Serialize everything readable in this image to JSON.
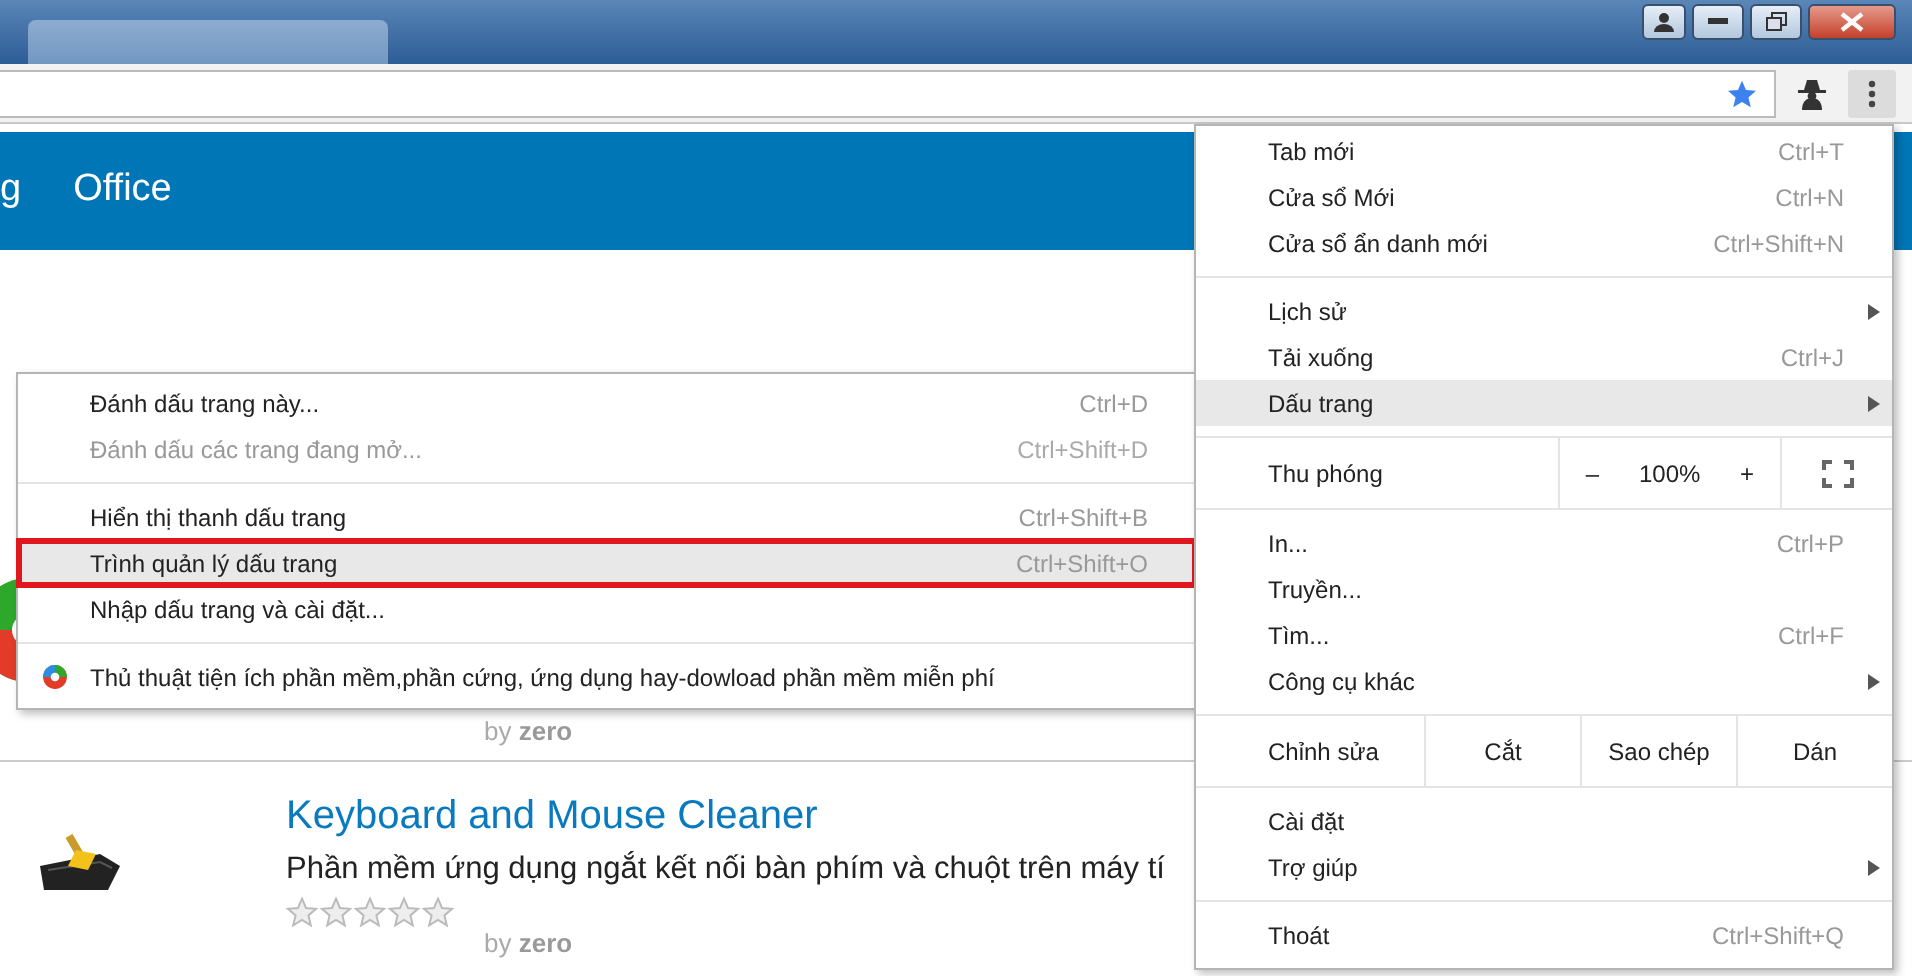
{
  "site_nav": {
    "items": [
      "g",
      "Office"
    ]
  },
  "listing": [
    {
      "kind": "partial",
      "byline": "by **zero**"
    },
    {
      "kind": "full",
      "title": "Keyboard and Mouse Cleaner",
      "description": "Phần mềm ứng dụng ngắt kết nối bàn phím và chuột trên máy tí",
      "stars": 0,
      "byline": "by **zero**"
    }
  ],
  "bookmark_submenu": [
    {
      "kind": "item",
      "label": "Đánh dấu trang này...",
      "shortcut": "Ctrl+D",
      "disabled": false,
      "selected": false,
      "outlined": false
    },
    {
      "kind": "item",
      "label": "Đánh dấu các trang đang mở...",
      "shortcut": "Ctrl+Shift+D",
      "disabled": true,
      "selected": false,
      "outlined": false
    },
    {
      "kind": "separator"
    },
    {
      "kind": "item",
      "label": "Hiển thị thanh dấu trang",
      "shortcut": "Ctrl+Shift+B",
      "disabled": false,
      "selected": false,
      "outlined": false
    },
    {
      "kind": "item",
      "label": "Trình quản lý dấu trang",
      "shortcut": "Ctrl+Shift+O",
      "disabled": false,
      "selected": true,
      "outlined": true
    },
    {
      "kind": "item",
      "label": "Nhập dấu trang và cài đặt...",
      "disabled": false,
      "selected": false,
      "outlined": false
    },
    {
      "kind": "separator"
    },
    {
      "kind": "bookmark",
      "label": "Thủ thuật tiện ích phần mềm,phần cứng, ứng dụng hay-dowload phần mềm miễn phí",
      "disabled": false,
      "selected": false,
      "outlined": false
    }
  ],
  "main_menu": [
    {
      "kind": "item",
      "label": "Tab mới",
      "shortcut": "Ctrl+T",
      "has_submenu": false,
      "selected": false
    },
    {
      "kind": "item",
      "label": "Cửa sổ Mới",
      "shortcut": "Ctrl+N",
      "has_submenu": false,
      "selected": false
    },
    {
      "kind": "item",
      "label": "Cửa sổ ẩn danh mới",
      "shortcut": "Ctrl+Shift+N",
      "has_submenu": false,
      "selected": false
    },
    {
      "kind": "separator"
    },
    {
      "kind": "item",
      "label": "Lịch sử",
      "has_submenu": true,
      "selected": false
    },
    {
      "kind": "item",
      "label": "Tải xuống",
      "shortcut": "Ctrl+J",
      "has_submenu": false,
      "selected": false
    },
    {
      "kind": "item",
      "label": "Dấu trang",
      "has_submenu": true,
      "selected": true
    },
    {
      "kind": "separator"
    },
    {
      "kind": "zoom",
      "label": "Thu phóng",
      "minus": "–",
      "value": "100%",
      "plus": "+"
    },
    {
      "kind": "separator"
    },
    {
      "kind": "item",
      "label": "In...",
      "shortcut": "Ctrl+P",
      "has_submenu": false,
      "selected": false
    },
    {
      "kind": "item",
      "label": "Truyền...",
      "has_submenu": false,
      "selected": false
    },
    {
      "kind": "item",
      "label": "Tìm...",
      "shortcut": "Ctrl+F",
      "has_submenu": false,
      "selected": false
    },
    {
      "kind": "item",
      "label": "Công cụ khác",
      "has_submenu": true,
      "selected": false
    },
    {
      "kind": "separator"
    },
    {
      "kind": "edit",
      "label": "Chỉnh sửa",
      "buttons": [
        "Cắt",
        "Sao chép",
        "Dán"
      ]
    },
    {
      "kind": "separator"
    },
    {
      "kind": "item",
      "label": "Cài đặt",
      "has_submenu": false,
      "selected": false
    },
    {
      "kind": "item",
      "label": "Trợ giúp",
      "has_submenu": true,
      "selected": false
    },
    {
      "kind": "separator"
    },
    {
      "kind": "item",
      "label": "Thoát",
      "shortcut": "Ctrl+Shift+Q",
      "has_submenu": false,
      "selected": false
    }
  ]
}
